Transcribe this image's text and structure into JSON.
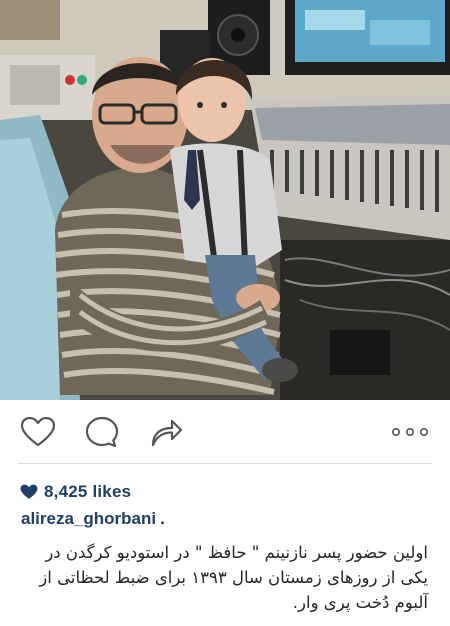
{
  "post": {
    "image_alt": "",
    "actions": {
      "like_icon": "heart-outline-icon",
      "comment_icon": "comment-bubble-icon",
      "share_icon": "share-arrow-icon",
      "more_icon": "more-dots-icon"
    },
    "likes": {
      "icon": "heart-filled-icon",
      "text": "8,425 likes"
    },
    "author": {
      "username": "alireza_ghorbani",
      "suffix": "."
    },
    "caption": {
      "line1": "اولین حضور پسر نازنینم \" حافظ \" در استودیو کرگدن در",
      "line2": "یکی از روزهای زمستان سال ۱۳۹۳ برای ضبط لحظاتی از",
      "line3": "آلبوم دُخت پری وار."
    },
    "colors": {
      "link_blue": "#1f3f66",
      "icon_gray": "#555555",
      "divider": "#dbdbdb"
    }
  }
}
